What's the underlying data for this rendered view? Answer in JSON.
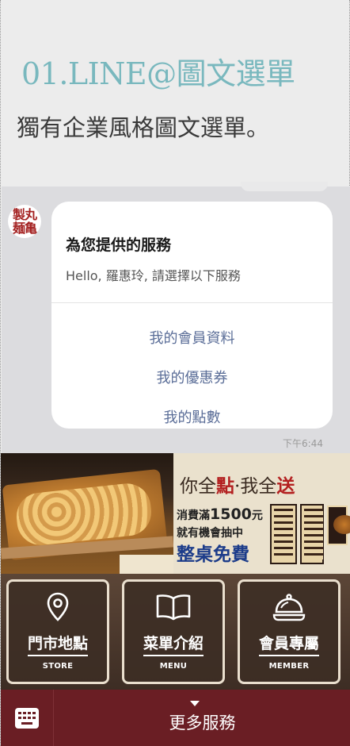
{
  "header": {
    "title": "01.LINE@圖文選單",
    "subtitle": "獨有企業風格圖文選單。"
  },
  "chat": {
    "avatar_text": "製丸麺亀",
    "card": {
      "title": "為您提供的服務",
      "greeting": "Hello, 羅惠玲, 請選擇以下服務",
      "options": [
        "我的會員資料",
        "我的優惠券",
        "我的點數"
      ]
    },
    "timestamp": "下午6:44"
  },
  "richmenu": {
    "promo": {
      "title_a": "你全",
      "title_b": "點",
      "title_c": "·我全",
      "title_d": "送",
      "line1_a": "消費滿",
      "line1_b": "1500",
      "line1_c": "元",
      "line2": "就有機會抽中",
      "line3": "整桌免費"
    },
    "buttons": [
      {
        "zh": "門市地點",
        "en": "STORE",
        "icon": "location-pin-icon"
      },
      {
        "zh": "菜單介紹",
        "en": "MENU",
        "icon": "open-book-icon"
      },
      {
        "zh": "會員專屬",
        "en": "MEMBER",
        "icon": "cloche-icon"
      }
    ]
  },
  "bottom_bar": {
    "keyboard_icon": "keyboard-icon",
    "more_label": "更多服務"
  }
}
